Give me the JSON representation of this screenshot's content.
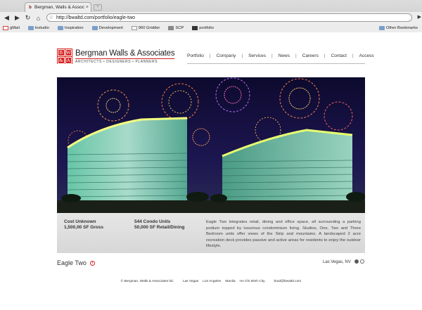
{
  "browser": {
    "tab_title": "Bergman, Walls & Assoc...",
    "url": "http://bwaltd.com/portfolio/eagle-two",
    "bookmarks": [
      "gMail",
      "lostudio",
      "Inspiration",
      "Development",
      "960 Gridder",
      "SCP",
      "portfolio"
    ],
    "other_bookmarks": "Other Bookmarks"
  },
  "site": {
    "logo_letters": [
      "B",
      "W",
      "&",
      "A"
    ],
    "logo_name": "Bergman Walls & Associates",
    "logo_tagline": "ARCHITECTS • DESIGNERS • PLANNERS",
    "nav": [
      "Portfolio",
      "Company",
      "Services",
      "News",
      "Careers",
      "Contact",
      "Access"
    ]
  },
  "project": {
    "stats_left": [
      "Cost Unknown",
      "1,500,00 SF Gross"
    ],
    "stats_right": [
      "544 Condo Units",
      "50,000 SF Retail/Dining"
    ],
    "description": "Eagle Two integrates retail, dining and office space, all surrounding a parking podium topped by luxurious condominium living. Studios, One, Two and Three Bedroom units offer views of the Strip and mountains. A landscaped 2 acre recreation deck provides passive and active areas for residents to enjoy the outdoor lifestyle.",
    "name": "Eagle Two",
    "location": "Las Vegas, NV",
    "slide_index": 1,
    "slide_count": 2
  },
  "footer": {
    "copyright": "© Bergman, Walls & Associates ltd.",
    "offices": [
      "Las Vegas",
      "Los Angeles",
      "Manila",
      "Ho Chi Minh City"
    ],
    "email": "brad@bwaltd.com"
  }
}
